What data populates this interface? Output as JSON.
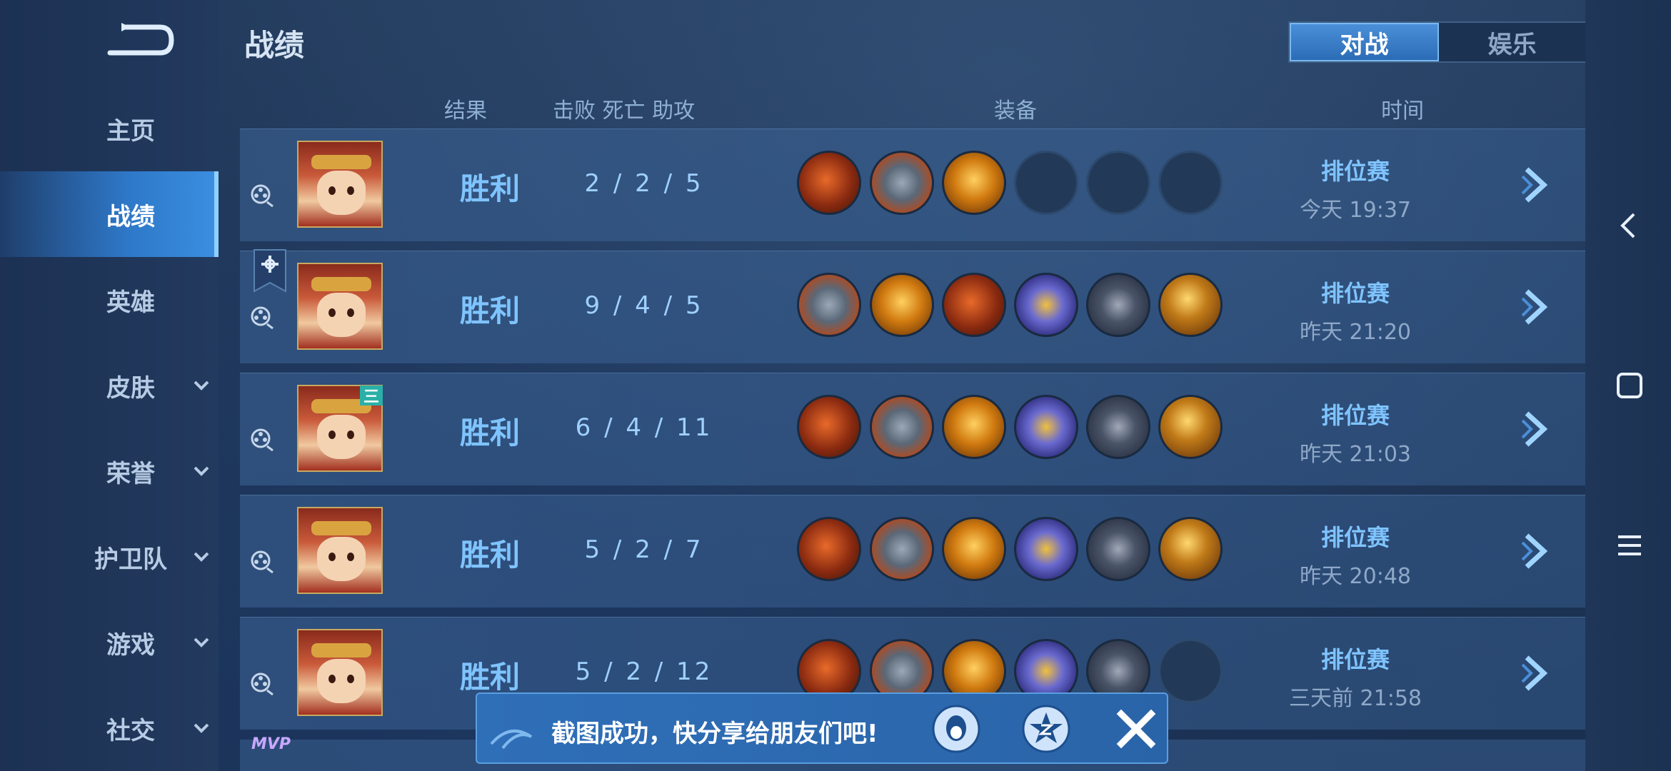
{
  "sidebar": {
    "items": [
      {
        "label": "主页",
        "has_chevron": false,
        "active": false
      },
      {
        "label": "战绩",
        "has_chevron": false,
        "active": true
      },
      {
        "label": "英雄",
        "has_chevron": false,
        "active": false
      },
      {
        "label": "皮肤",
        "has_chevron": true,
        "active": false
      },
      {
        "label": "荣誉",
        "has_chevron": true,
        "active": false
      },
      {
        "label": "护卫队",
        "has_chevron": true,
        "active": false
      },
      {
        "label": "游戏",
        "has_chevron": true,
        "active": false
      },
      {
        "label": "社交",
        "has_chevron": true,
        "active": false
      }
    ]
  },
  "header": {
    "title": "战绩",
    "toggle": {
      "options": [
        "对战",
        "娱乐"
      ],
      "selected": "对战"
    }
  },
  "columns": {
    "result": "结果",
    "kda": "击败  死亡  助攻",
    "equipment": "装备",
    "time": "时间"
  },
  "matches": [
    {
      "result": "胜利",
      "kda": "2 / 2 / 5",
      "mode": "排位赛",
      "time": "今天 19:37",
      "items": [
        "a",
        "b",
        "c",
        "",
        "",
        ""
      ]
    },
    {
      "result": "胜利",
      "kda": "9 / 4 / 5",
      "mode": "排位赛",
      "time": "昨天 21:20",
      "items": [
        "b",
        "c",
        "a",
        "d",
        "e",
        "f"
      ]
    },
    {
      "result": "胜利",
      "kda": "6 / 4 / 11",
      "mode": "排位赛",
      "time": "昨天 21:03",
      "items": [
        "a",
        "b",
        "c",
        "d",
        "e",
        "f"
      ]
    },
    {
      "result": "胜利",
      "kda": "5 / 2 / 7",
      "mode": "排位赛",
      "time": "昨天 20:48",
      "items": [
        "a",
        "b",
        "c",
        "d",
        "e",
        "f"
      ]
    },
    {
      "result": "胜利",
      "kda": "5 / 2 / 12",
      "mode": "排位赛",
      "time": "三天前 21:58",
      "items": [
        "a",
        "b",
        "c",
        "d",
        "e",
        ""
      ]
    }
  ],
  "badge_number": "三",
  "mvp_label": "MVP",
  "toast": {
    "message": "截图成功，快分享给朋友们吧!",
    "share_icons": [
      "qq-icon",
      "qzone-icon"
    ],
    "close_icon": "close-icon"
  },
  "colors": {
    "accent": "#7fc4ff",
    "active_nav": "#2e78c8",
    "toast_bg": "#2f6fb8"
  }
}
